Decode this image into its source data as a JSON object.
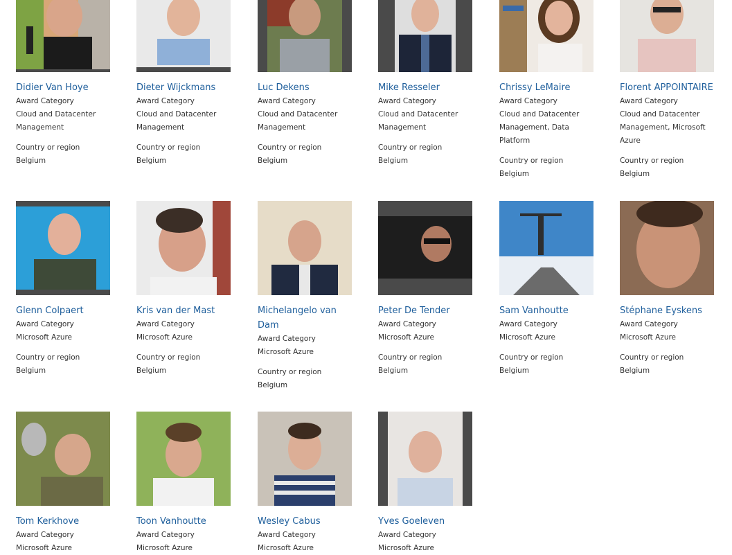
{
  "labels": {
    "award_category": "Award Category",
    "country_or_region": "Country or region"
  },
  "people": [
    {
      "name": "Didier Van Hoye",
      "award": "Cloud and Datacenter Management",
      "country": "Belgium"
    },
    {
      "name": "Dieter Wijckmans",
      "award": "Cloud and Datacenter Management",
      "country": "Belgium"
    },
    {
      "name": "Luc Dekens",
      "award": "Cloud and Datacenter Management",
      "country": "Belgium"
    },
    {
      "name": "Mike Resseler",
      "award": "Cloud and Datacenter Management",
      "country": "Belgium"
    },
    {
      "name": "Chrissy LeMaire",
      "award": "Cloud and Datacenter Management, Data Platform",
      "country": "Belgium"
    },
    {
      "name": "Florent APPOINTAIRE",
      "award": "Cloud and Datacenter Management, Microsoft Azure",
      "country": "Belgium"
    },
    {
      "name": "Glenn Colpaert",
      "award": "Microsoft Azure",
      "country": "Belgium"
    },
    {
      "name": "Kris van der Mast",
      "award": "Microsoft Azure",
      "country": "Belgium"
    },
    {
      "name": "Michelangelo van Dam",
      "award": "Microsoft Azure",
      "country": "Belgium"
    },
    {
      "name": "Peter De Tender",
      "award": "Microsoft Azure",
      "country": "Belgium"
    },
    {
      "name": "Sam Vanhoutte",
      "award": "Microsoft Azure",
      "country": "Belgium"
    },
    {
      "name": "Stéphane Eyskens",
      "award": "Microsoft Azure",
      "country": "Belgium"
    },
    {
      "name": "Tom Kerkhove",
      "award": "Microsoft Azure",
      "country": ""
    },
    {
      "name": "Toon Vanhoutte",
      "award": "Microsoft Azure",
      "country": ""
    },
    {
      "name": "Wesley Cabus",
      "award": "Microsoft Azure",
      "country": ""
    },
    {
      "name": "Yves Goeleven",
      "award": "Microsoft Azure",
      "country": ""
    }
  ],
  "colors": {
    "name_link": "#1f5f9c",
    "frame_gray": "#4a4a4a",
    "badge_blue": "#2b79c8"
  }
}
